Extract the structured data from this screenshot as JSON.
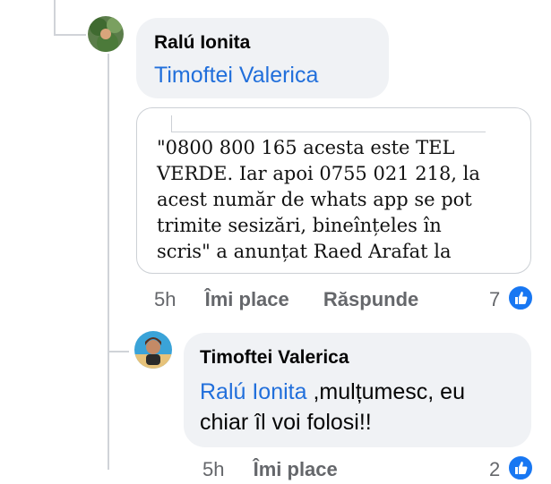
{
  "comment1": {
    "author": "Ralú Ionita",
    "mention": "Timoftei Valerica"
  },
  "quote": {
    "lines": [
      "\"0800 800 165 acesta este TEL",
      "VERDE. Iar apoi 0755 021 218, la",
      "acest număr de whats app se pot",
      "trimite sesizări, bineînțeles în",
      "scris\" a anunțat Raed Arafat la"
    ]
  },
  "actions1": {
    "time": "5h",
    "like": "Îmi place",
    "reply": "Răspunde",
    "reactions": "7"
  },
  "reply1": {
    "author": "Timoftei Valerica",
    "mention": "Ralú Ionita",
    "text_after_mention": " ,mulțumesc, eu",
    "text_line2": "chiar îl voi folosi!!"
  },
  "actions2": {
    "time": "5h",
    "like": "Îmi place",
    "reactions": "2"
  },
  "icons": {
    "like": "thumbs-up-icon"
  },
  "colors": {
    "mention": "#216fdb",
    "bubble": "#f0f2f5",
    "meta": "#65676b",
    "like_badge": "#1877f2"
  }
}
